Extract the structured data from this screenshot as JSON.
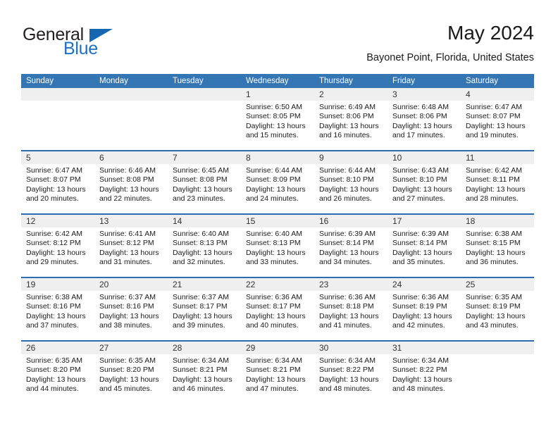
{
  "brand": {
    "word_one": "General",
    "word_two": "Blue",
    "triangle_icon": "brand-triangle-icon",
    "colors": {
      "general_text": "#231f20",
      "blue_text": "#1f6fc4",
      "triangle": "#1567b2"
    }
  },
  "header": {
    "title": "May 2024",
    "subtitle": "Bayonet Point, Florida, United States"
  },
  "theme": {
    "header_bg": "#3475b4",
    "header_text": "#ffffff",
    "row_divider": "#2b6cb0",
    "daynum_band_bg": "#efeff0",
    "cell_bg": "#ffffff",
    "body_text": "#1a1a1a"
  },
  "calendar": {
    "columns": [
      "Sunday",
      "Monday",
      "Tuesday",
      "Wednesday",
      "Thursday",
      "Friday",
      "Saturday"
    ],
    "labels": {
      "sunrise": "Sunrise:",
      "sunset": "Sunset:",
      "daylight": "Daylight:"
    },
    "weeks": [
      [
        {
          "day": "",
          "empty": true
        },
        {
          "day": "",
          "empty": true
        },
        {
          "day": "",
          "empty": true
        },
        {
          "day": "1",
          "sunrise": "Sunrise: 6:50 AM",
          "sunset": "Sunset: 8:05 PM",
          "daylight": "Daylight: 13 hours and 15 minutes."
        },
        {
          "day": "2",
          "sunrise": "Sunrise: 6:49 AM",
          "sunset": "Sunset: 8:06 PM",
          "daylight": "Daylight: 13 hours and 16 minutes."
        },
        {
          "day": "3",
          "sunrise": "Sunrise: 6:48 AM",
          "sunset": "Sunset: 8:06 PM",
          "daylight": "Daylight: 13 hours and 17 minutes."
        },
        {
          "day": "4",
          "sunrise": "Sunrise: 6:47 AM",
          "sunset": "Sunset: 8:07 PM",
          "daylight": "Daylight: 13 hours and 19 minutes."
        }
      ],
      [
        {
          "day": "5",
          "sunrise": "Sunrise: 6:47 AM",
          "sunset": "Sunset: 8:07 PM",
          "daylight": "Daylight: 13 hours and 20 minutes."
        },
        {
          "day": "6",
          "sunrise": "Sunrise: 6:46 AM",
          "sunset": "Sunset: 8:08 PM",
          "daylight": "Daylight: 13 hours and 22 minutes."
        },
        {
          "day": "7",
          "sunrise": "Sunrise: 6:45 AM",
          "sunset": "Sunset: 8:08 PM",
          "daylight": "Daylight: 13 hours and 23 minutes."
        },
        {
          "day": "8",
          "sunrise": "Sunrise: 6:44 AM",
          "sunset": "Sunset: 8:09 PM",
          "daylight": "Daylight: 13 hours and 24 minutes."
        },
        {
          "day": "9",
          "sunrise": "Sunrise: 6:44 AM",
          "sunset": "Sunset: 8:10 PM",
          "daylight": "Daylight: 13 hours and 26 minutes."
        },
        {
          "day": "10",
          "sunrise": "Sunrise: 6:43 AM",
          "sunset": "Sunset: 8:10 PM",
          "daylight": "Daylight: 13 hours and 27 minutes."
        },
        {
          "day": "11",
          "sunrise": "Sunrise: 6:42 AM",
          "sunset": "Sunset: 8:11 PM",
          "daylight": "Daylight: 13 hours and 28 minutes."
        }
      ],
      [
        {
          "day": "12",
          "sunrise": "Sunrise: 6:42 AM",
          "sunset": "Sunset: 8:12 PM",
          "daylight": "Daylight: 13 hours and 29 minutes."
        },
        {
          "day": "13",
          "sunrise": "Sunrise: 6:41 AM",
          "sunset": "Sunset: 8:12 PM",
          "daylight": "Daylight: 13 hours and 31 minutes."
        },
        {
          "day": "14",
          "sunrise": "Sunrise: 6:40 AM",
          "sunset": "Sunset: 8:13 PM",
          "daylight": "Daylight: 13 hours and 32 minutes."
        },
        {
          "day": "15",
          "sunrise": "Sunrise: 6:40 AM",
          "sunset": "Sunset: 8:13 PM",
          "daylight": "Daylight: 13 hours and 33 minutes."
        },
        {
          "day": "16",
          "sunrise": "Sunrise: 6:39 AM",
          "sunset": "Sunset: 8:14 PM",
          "daylight": "Daylight: 13 hours and 34 minutes."
        },
        {
          "day": "17",
          "sunrise": "Sunrise: 6:39 AM",
          "sunset": "Sunset: 8:14 PM",
          "daylight": "Daylight: 13 hours and 35 minutes."
        },
        {
          "day": "18",
          "sunrise": "Sunrise: 6:38 AM",
          "sunset": "Sunset: 8:15 PM",
          "daylight": "Daylight: 13 hours and 36 minutes."
        }
      ],
      [
        {
          "day": "19",
          "sunrise": "Sunrise: 6:38 AM",
          "sunset": "Sunset: 8:16 PM",
          "daylight": "Daylight: 13 hours and 37 minutes."
        },
        {
          "day": "20",
          "sunrise": "Sunrise: 6:37 AM",
          "sunset": "Sunset: 8:16 PM",
          "daylight": "Daylight: 13 hours and 38 minutes."
        },
        {
          "day": "21",
          "sunrise": "Sunrise: 6:37 AM",
          "sunset": "Sunset: 8:17 PM",
          "daylight": "Daylight: 13 hours and 39 minutes."
        },
        {
          "day": "22",
          "sunrise": "Sunrise: 6:36 AM",
          "sunset": "Sunset: 8:17 PM",
          "daylight": "Daylight: 13 hours and 40 minutes."
        },
        {
          "day": "23",
          "sunrise": "Sunrise: 6:36 AM",
          "sunset": "Sunset: 8:18 PM",
          "daylight": "Daylight: 13 hours and 41 minutes."
        },
        {
          "day": "24",
          "sunrise": "Sunrise: 6:36 AM",
          "sunset": "Sunset: 8:19 PM",
          "daylight": "Daylight: 13 hours and 42 minutes."
        },
        {
          "day": "25",
          "sunrise": "Sunrise: 6:35 AM",
          "sunset": "Sunset: 8:19 PM",
          "daylight": "Daylight: 13 hours and 43 minutes."
        }
      ],
      [
        {
          "day": "26",
          "sunrise": "Sunrise: 6:35 AM",
          "sunset": "Sunset: 8:20 PM",
          "daylight": "Daylight: 13 hours and 44 minutes."
        },
        {
          "day": "27",
          "sunrise": "Sunrise: 6:35 AM",
          "sunset": "Sunset: 8:20 PM",
          "daylight": "Daylight: 13 hours and 45 minutes."
        },
        {
          "day": "28",
          "sunrise": "Sunrise: 6:34 AM",
          "sunset": "Sunset: 8:21 PM",
          "daylight": "Daylight: 13 hours and 46 minutes."
        },
        {
          "day": "29",
          "sunrise": "Sunrise: 6:34 AM",
          "sunset": "Sunset: 8:21 PM",
          "daylight": "Daylight: 13 hours and 47 minutes."
        },
        {
          "day": "30",
          "sunrise": "Sunrise: 6:34 AM",
          "sunset": "Sunset: 8:22 PM",
          "daylight": "Daylight: 13 hours and 48 minutes."
        },
        {
          "day": "31",
          "sunrise": "Sunrise: 6:34 AM",
          "sunset": "Sunset: 8:22 PM",
          "daylight": "Daylight: 13 hours and 48 minutes."
        },
        {
          "day": "",
          "empty": true
        }
      ]
    ]
  }
}
